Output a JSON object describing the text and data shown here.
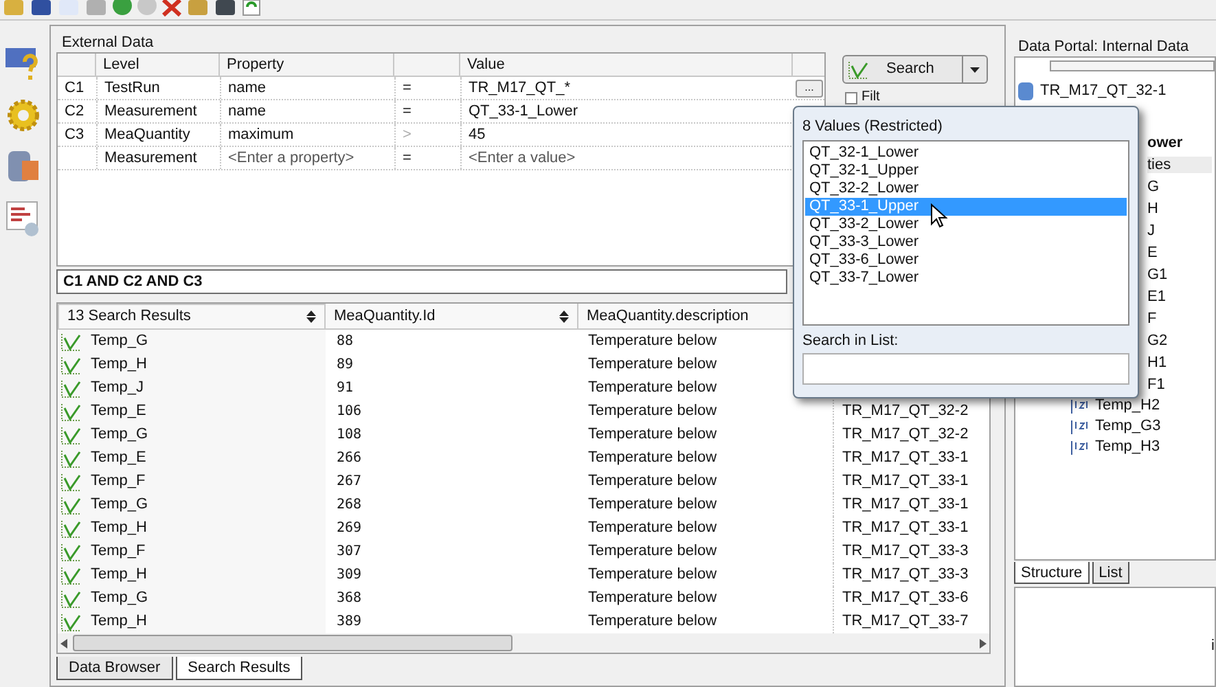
{
  "external_data": {
    "title": "External Data",
    "columns": [
      "Level",
      "Property",
      "Value"
    ],
    "conditions": [
      {
        "index": "C1",
        "level": "TestRun",
        "property": "name",
        "operator": "=",
        "value": "TR_M17_QT_*",
        "placeholder": false,
        "operator_disabled": false
      },
      {
        "index": "C2",
        "level": "Measurement",
        "property": "name",
        "operator": "=",
        "value": "QT_33-1_Lower",
        "placeholder": false,
        "operator_disabled": false
      },
      {
        "index": "C3",
        "level": "MeaQuantity",
        "property": "maximum",
        "operator": ">",
        "value": "45",
        "placeholder": false,
        "operator_disabled": true
      },
      {
        "level": "Measurement",
        "property": "<Enter a property>",
        "operator": "=",
        "value": "<Enter a value>",
        "placeholder": true,
        "operator_disabled": false
      }
    ],
    "browse_button": "...",
    "search_button": "Search",
    "filter_label": "Filt",
    "filter_checked": false,
    "expression": "C1 AND C2 AND C3"
  },
  "results": {
    "columns": [
      "13 Search Results",
      "MeaQuantity.Id",
      "MeaQuantity.description"
    ],
    "rows": [
      {
        "name": "Temp_G",
        "id": "88",
        "description": "Temperature below"
      },
      {
        "name": "Temp_H",
        "id": "89",
        "description": "Temperature below"
      },
      {
        "name": "Temp_J",
        "id": "91",
        "description": "Temperature below"
      },
      {
        "name": "Temp_E",
        "id": "106",
        "description": "Temperature below",
        "column_4": "TR_M17_QT_32-2"
      },
      {
        "name": "Temp_G",
        "id": "108",
        "description": "Temperature below",
        "column_4": "TR_M17_QT_32-2"
      },
      {
        "name": "Temp_E",
        "id": "266",
        "description": "Temperature below",
        "column_4": "TR_M17_QT_33-1"
      },
      {
        "name": "Temp_F",
        "id": "267",
        "description": "Temperature below",
        "column_4": "TR_M17_QT_33-1"
      },
      {
        "name": "Temp_G",
        "id": "268",
        "description": "Temperature below",
        "column_4": "TR_M17_QT_33-1"
      },
      {
        "name": "Temp_H",
        "id": "269",
        "description": "Temperature below",
        "column_4": "TR_M17_QT_33-1"
      },
      {
        "name": "Temp_F",
        "id": "307",
        "description": "Temperature below",
        "column_4": "TR_M17_QT_33-3"
      },
      {
        "name": "Temp_H",
        "id": "309",
        "description": "Temperature below",
        "column_4": "TR_M17_QT_33-3"
      },
      {
        "name": "Temp_G",
        "id": "368",
        "description": "Temperature below",
        "column_4": "TR_M17_QT_33-6"
      },
      {
        "name": "Temp_H",
        "id": "389",
        "description": "Temperature below",
        "column_4": "TR_M17_QT_33-7"
      }
    ]
  },
  "bottom_tabs": [
    {
      "label": "Data Browser",
      "selected": false
    },
    {
      "label": "Search Results",
      "selected": true
    }
  ],
  "data_portal": {
    "title": "Data Portal: Internal Data",
    "tree": [
      {
        "label": "TR_M17_QT_32-1",
        "kind": "root",
        "selected": false
      },
      {
        "kind": "gap"
      },
      {
        "label": "ower",
        "kind": "bold",
        "selected": false
      },
      {
        "label": "ties",
        "kind": "plain",
        "selected": true
      },
      {
        "label": "G",
        "kind": "plain",
        "selected": false
      },
      {
        "label": "H",
        "kind": "plain",
        "selected": false
      },
      {
        "label": "J",
        "kind": "plain",
        "selected": false
      },
      {
        "label": "E",
        "kind": "plain",
        "selected": false
      },
      {
        "label": "G1",
        "kind": "plain",
        "selected": false
      },
      {
        "label": "E1",
        "kind": "plain",
        "selected": false
      },
      {
        "label": "F",
        "kind": "plain",
        "selected": false
      },
      {
        "label": "G2",
        "kind": "plain",
        "selected": false
      },
      {
        "label": "H1",
        "kind": "plain",
        "selected": false
      },
      {
        "label": "F1",
        "kind": "plain",
        "selected": false
      },
      {
        "label": "Temp_H2",
        "kind": "channel",
        "selected": false
      },
      {
        "label": "Temp_G3",
        "kind": "channel",
        "selected": false
      },
      {
        "label": "Temp_H3",
        "kind": "channel",
        "selected": false
      }
    ],
    "tabs": [
      {
        "label": "Structure",
        "selected": true
      },
      {
        "label": "List",
        "selected": false
      }
    ],
    "lower_text": "i"
  },
  "popup": {
    "title": "8 Values (Restricted)",
    "items": [
      {
        "label": "QT_32-1_Lower",
        "selected": false
      },
      {
        "label": "QT_32-1_Upper",
        "selected": false
      },
      {
        "label": "QT_32-2_Lower",
        "selected": false
      },
      {
        "label": "QT_33-1_Upper",
        "selected": true
      },
      {
        "label": "QT_33-2_Lower",
        "selected": false
      },
      {
        "label": "QT_33-3_Lower",
        "selected": false
      },
      {
        "label": "QT_33-6_Lower",
        "selected": false
      },
      {
        "label": "QT_33-7_Lower",
        "selected": false
      }
    ],
    "search_label": "Search in List:"
  }
}
